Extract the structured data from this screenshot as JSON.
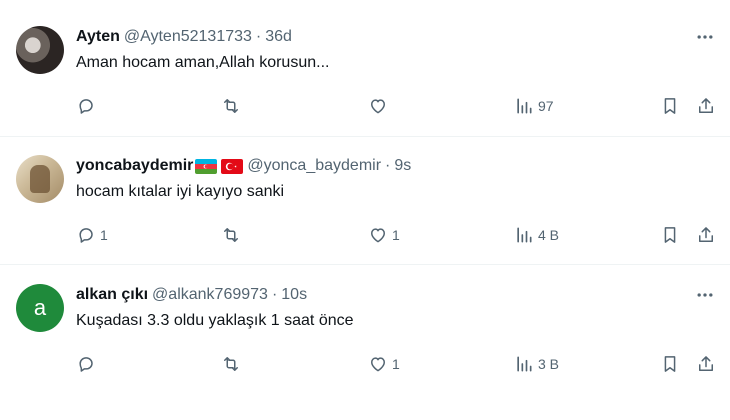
{
  "tweets": [
    {
      "name": "Ayten",
      "handle": "@Ayten52131733",
      "time": "36d",
      "text": "Aman hocam aman,Allah korusun...",
      "replies": "",
      "retweets": "",
      "likes": "",
      "views": "97"
    },
    {
      "name": "yoncabaydemir",
      "handle": "@yonca_baydemir",
      "time": "9s",
      "text": "hocam kıtalar iyi kayıyo sanki",
      "replies": "1",
      "retweets": "",
      "likes": "1",
      "views": "4 B",
      "flags": [
        "azerbaijan-flag",
        "turkey-flag"
      ]
    },
    {
      "name": "alkan çıkı",
      "handle": "@alkank769973",
      "time": "10s",
      "text": "Kuşadası 3.3 oldu yaklaşık 1 saat önce",
      "avatar_letter": "a",
      "replies": "",
      "retweets": "",
      "likes": "1",
      "views": "3 B"
    }
  ],
  "separator": "·",
  "colors": {
    "text": "#0f1419",
    "muted": "#536471",
    "border": "#eff3f4",
    "avatar_green": "#1f8a3b"
  }
}
